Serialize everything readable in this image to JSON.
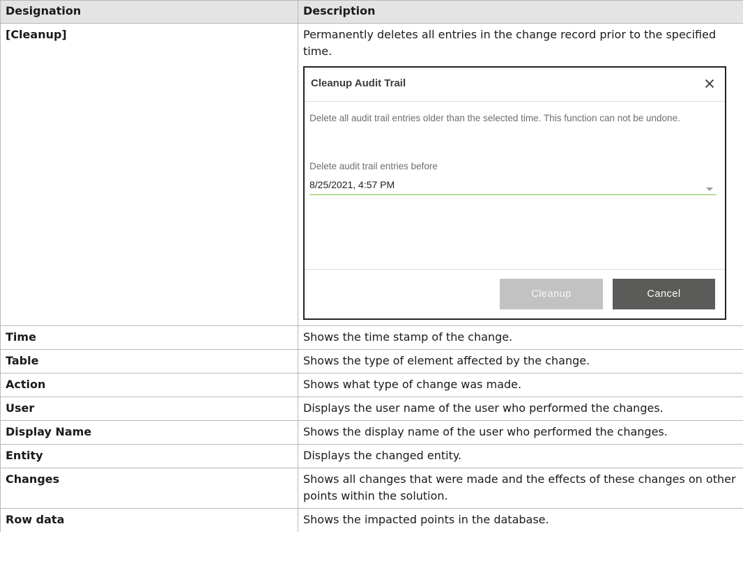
{
  "table": {
    "headers": [
      "Designation",
      "Description"
    ],
    "cleanup_row": {
      "name": "[Cleanup]",
      "description": "Permanently deletes all entries in the change record prior to the specified time."
    },
    "rows": [
      {
        "name": "Time",
        "description": "Shows the time stamp of the change."
      },
      {
        "name": "Table",
        "description": "Shows the type of element affected by the change."
      },
      {
        "name": "Action",
        "description": "Shows what type of change was made."
      },
      {
        "name": "User",
        "description": "Displays the user name of the user who performed the changes."
      },
      {
        "name": "Display Name",
        "description": "Shows the display name of the user who performed the changes."
      },
      {
        "name": "Entity",
        "description": "Displays the changed entity."
      },
      {
        "name": "Changes",
        "description": "Shows all changes that were made and the effects of these changes on other points within the solution."
      },
      {
        "name": "Row data",
        "description": "Shows the impacted points in the database."
      }
    ]
  },
  "dialog": {
    "title": "Cleanup Audit Trail",
    "close_icon": "close-icon",
    "description": "Delete all audit trail entries older than the selected time. This function can not be undone.",
    "field_label": "Delete audit trail entries before",
    "selected_value": "8/25/2021, 4:57 PM",
    "dropdown_icon": "caret-down-icon",
    "cleanup_label": "Cleanup",
    "cancel_label": "Cancel",
    "colors": {
      "field_underline": "#7cc242",
      "cleanup_button": "#c2c2c2",
      "cancel_button": "#5b5b59"
    }
  }
}
